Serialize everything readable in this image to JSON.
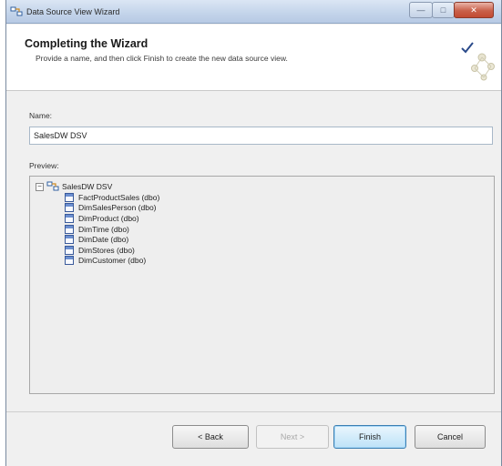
{
  "window": {
    "title": "Data Source View Wizard"
  },
  "header": {
    "title": "Completing the Wizard",
    "subtitle": "Provide a name, and then click Finish to create the new data source view."
  },
  "form": {
    "name_label": "Name:",
    "name_value": "SalesDW DSV",
    "preview_label": "Preview:"
  },
  "tree": {
    "root": "SalesDW DSV",
    "items": [
      "FactProductSales (dbo)",
      "DimSalesPerson (dbo)",
      "DimProduct (dbo)",
      "DimTime (dbo)",
      "DimDate (dbo)",
      "DimStores (dbo)",
      "DimCustomer (dbo)"
    ]
  },
  "buttons": {
    "back": "< Back",
    "next": "Next >",
    "finish": "Finish",
    "cancel": "Cancel"
  },
  "colors": {
    "titlebar": "#c3d4ea",
    "finish_border": "#3c7fb1",
    "table_icon": "#3a5a9a"
  }
}
